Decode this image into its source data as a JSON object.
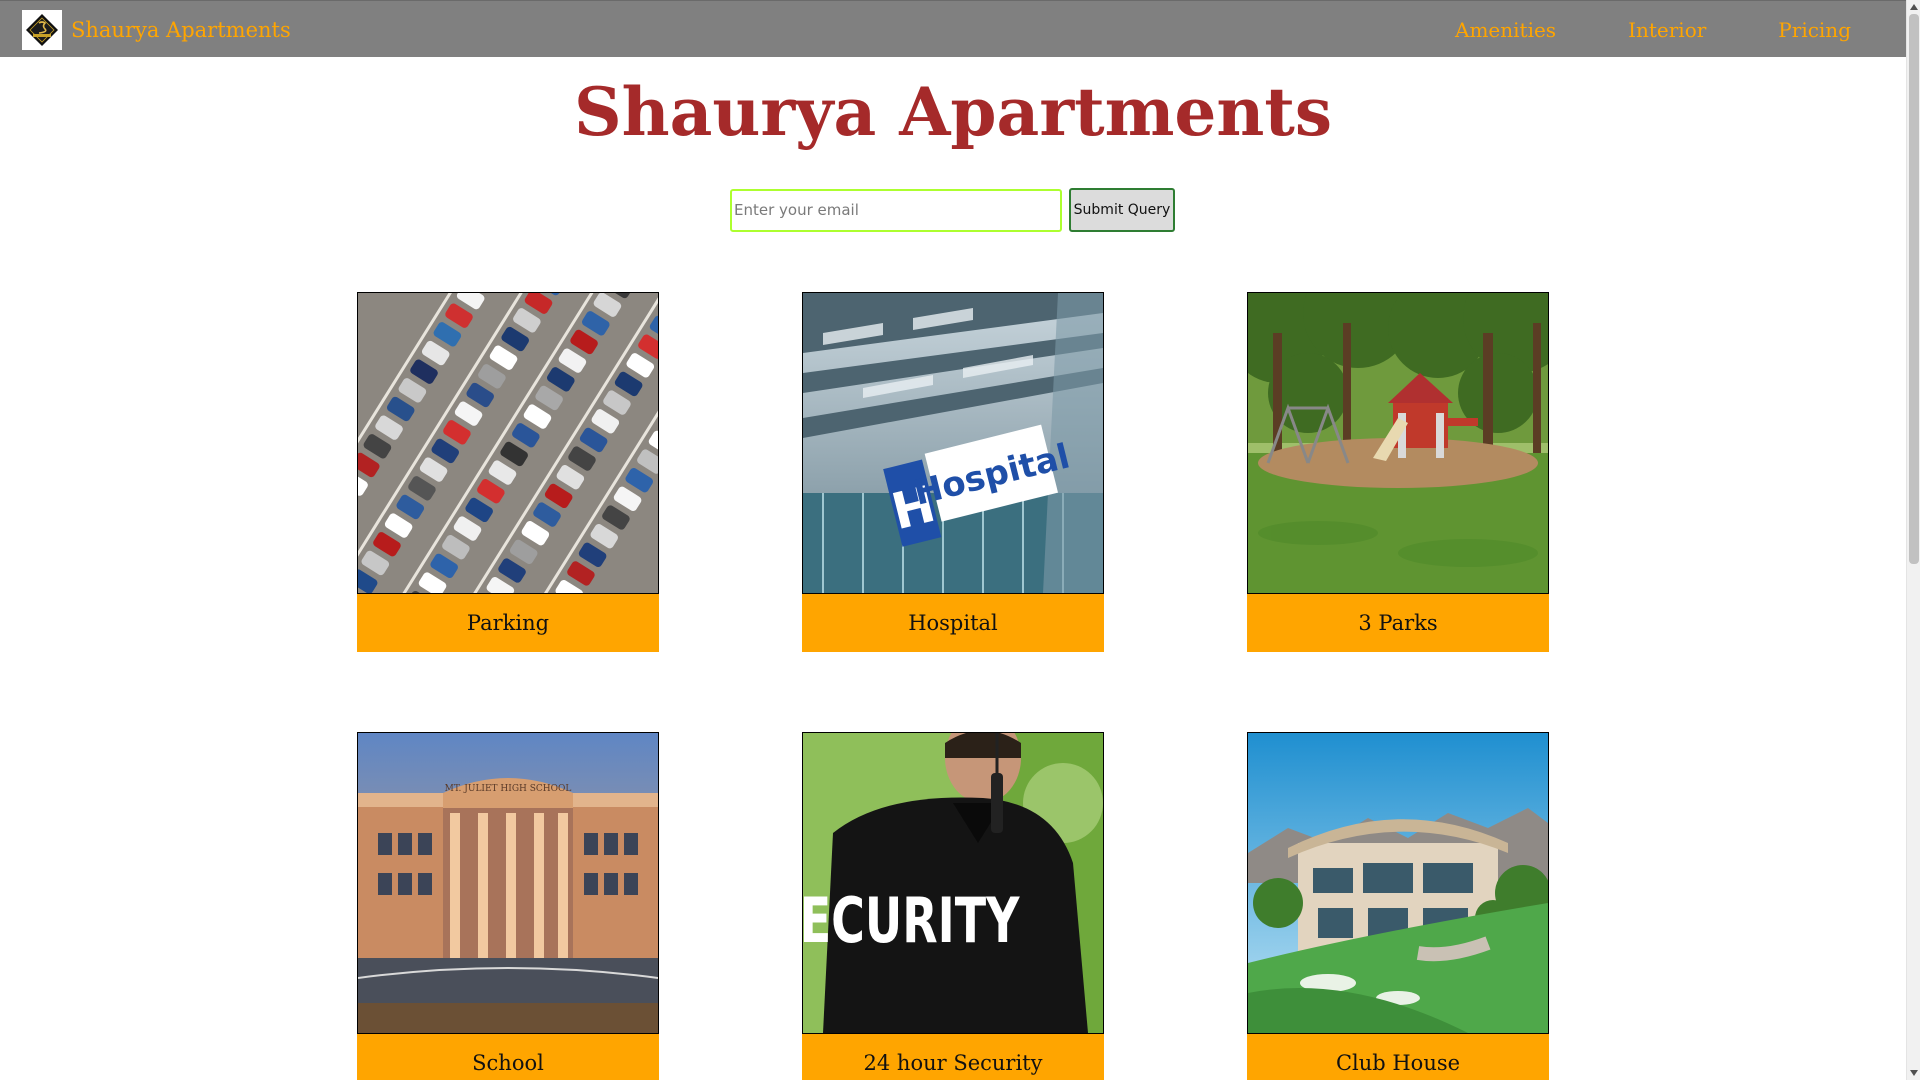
{
  "navbar": {
    "brand_name": "Shaurya Apartments",
    "logo_icon": "building-logo-icon",
    "links": [
      {
        "label": "Amenities"
      },
      {
        "label": "Interior"
      },
      {
        "label": "Pricing"
      }
    ]
  },
  "hero": {
    "title": "Shaurya Apartments",
    "email_placeholder": "Enter your email",
    "email_value": "",
    "submit_label": "Submit Query"
  },
  "amenities": [
    {
      "label": "Parking",
      "image": "parking-lot-photo"
    },
    {
      "label": "Hospital",
      "image": "hospital-sign-photo"
    },
    {
      "label": "3 Parks",
      "image": "park-playground-photo"
    },
    {
      "label": "School",
      "image": "school-building-photo"
    },
    {
      "label": "24 hour Security",
      "image": "security-guard-photo"
    },
    {
      "label": "Club House",
      "image": "club-house-photo"
    }
  ],
  "image_text": {
    "hospital_sign": "Hospital",
    "school_sign": "MT. JULIET HIGH SCHOOL",
    "security_jacket": "SECURITY"
  },
  "colors": {
    "navbar_bg": "#808080",
    "accent": "#ffa500",
    "title": "#a52a2a",
    "email_border": "#adff2f",
    "submit_border": "#2e7d32"
  }
}
